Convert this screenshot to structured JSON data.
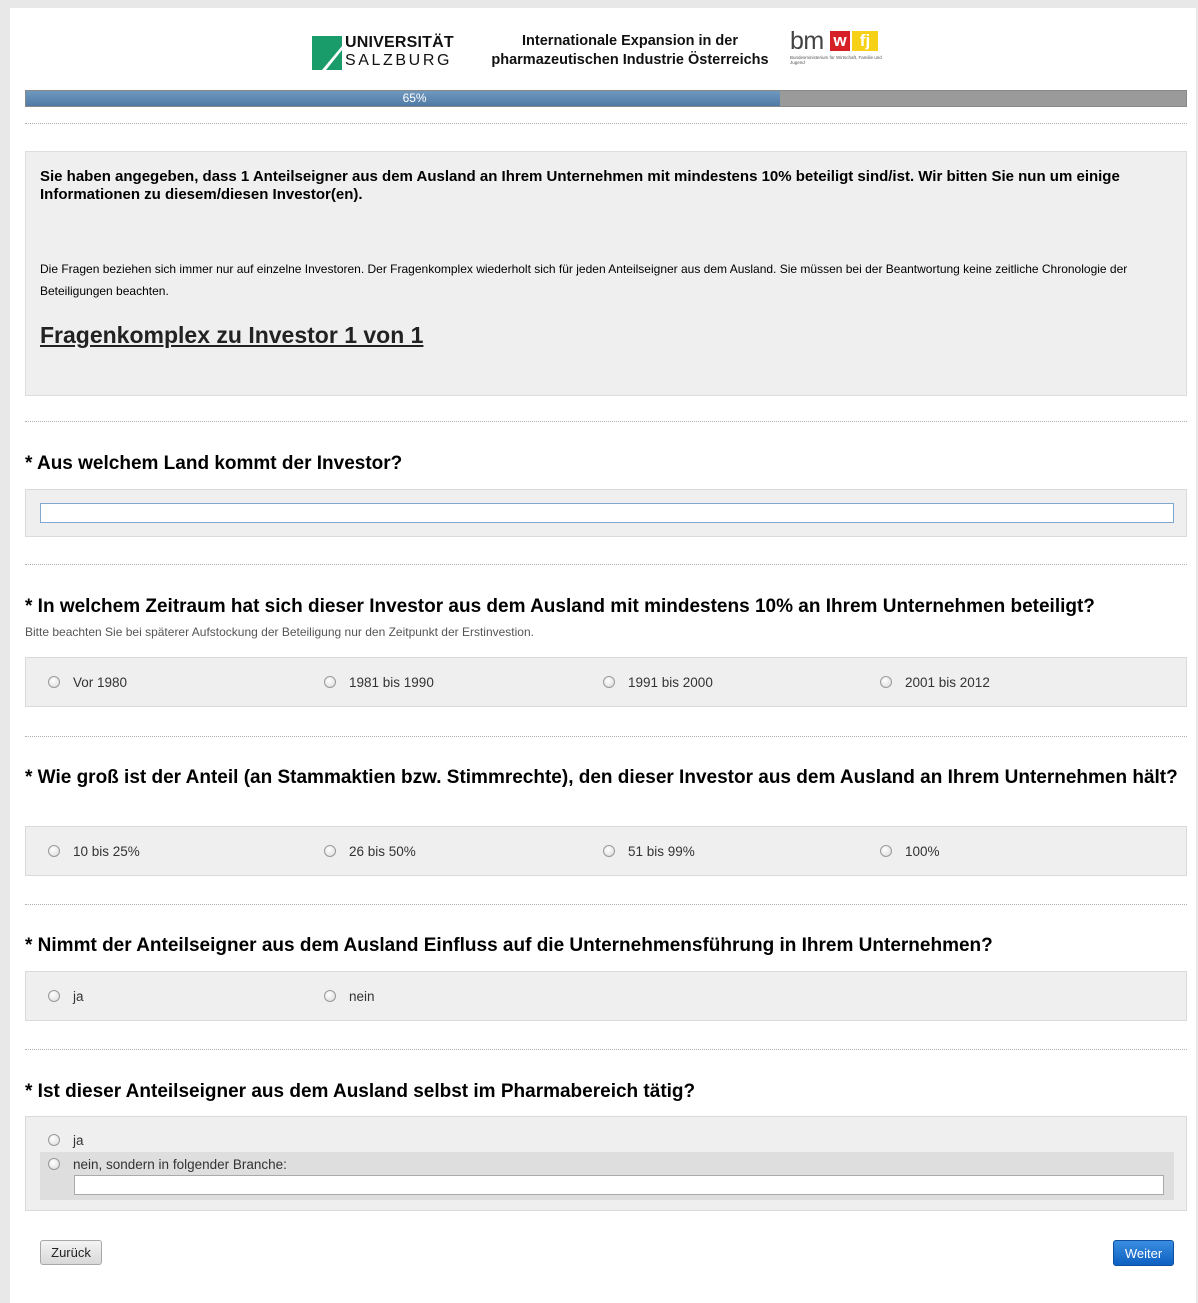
{
  "header": {
    "university_line1": "UNIVERSITÄT",
    "university_line2": "SALZBURG",
    "title_line1": "Internationale Expansion in der",
    "title_line2": "pharmazeutischen Industrie Österreichs",
    "ministry_logo_bm": "bm",
    "ministry_logo_w": "w",
    "ministry_logo_fj": "fj",
    "ministry_subtitle": "Bundesministerium für Wirtschaft, Familie und Jugend",
    "brand_color_green": "#1a9b6a",
    "brand_color_red": "#d61f26",
    "brand_color_yellow": "#f7d117"
  },
  "progress": {
    "label": "65%",
    "value_percent": 65
  },
  "intro": {
    "bold_text": "Sie haben angegeben, dass 1 Anteilseigner aus dem Ausland an Ihrem Unternehmen mit mindestens 10% beteiligt sind/ist. Wir bitten Sie nun um einige Informationen zu diesem/diesen Investor(en).",
    "text": "Die Fragen beziehen sich immer nur auf einzelne Investoren. Der Fragenkomplex wiederholt sich für jeden Anteilseigner aus dem Ausland. Sie müssen bei der Beantwortung keine zeitliche Chronologie der Beteiligungen beachten.",
    "heading": "Fragenkomplex zu Investor 1 von 1"
  },
  "q1": {
    "label": "* Aus welchem Land kommt der Investor?",
    "value": ""
  },
  "q2": {
    "label": "* In welchem Zeitraum hat sich dieser Investor aus dem Ausland mit mindestens 10% an Ihrem Unternehmen beteiligt?",
    "hint": "Bitte beachten Sie bei späterer Aufstockung der Beteiligung nur den Zeitpunkt der Erstinvestion.",
    "options": [
      "Vor 1980",
      "1981 bis 1990",
      "1991 bis 2000",
      "2001 bis 2012"
    ]
  },
  "q3": {
    "label": "* Wie groß ist der Anteil (an Stammaktien bzw. Stimmrechte), den dieser Investor aus dem Ausland an Ihrem Unternehmen hält?",
    "options": [
      "10 bis 25%",
      "26 bis 50%",
      "51 bis 99%",
      "100%"
    ]
  },
  "q4": {
    "label": "* Nimmt der Anteilseigner aus dem Ausland Einfluss auf die Unternehmensführung in Ihrem Unternehmen?",
    "options": [
      "ja",
      "nein"
    ]
  },
  "q5": {
    "label": "* Ist dieser Anteilseigner aus dem Ausland selbst im Pharmabereich tätig?",
    "options": [
      "ja",
      "nein, sondern in folgender Branche:"
    ],
    "branche_value": ""
  },
  "buttons": {
    "back": "Zurück",
    "next": "Weiter"
  }
}
